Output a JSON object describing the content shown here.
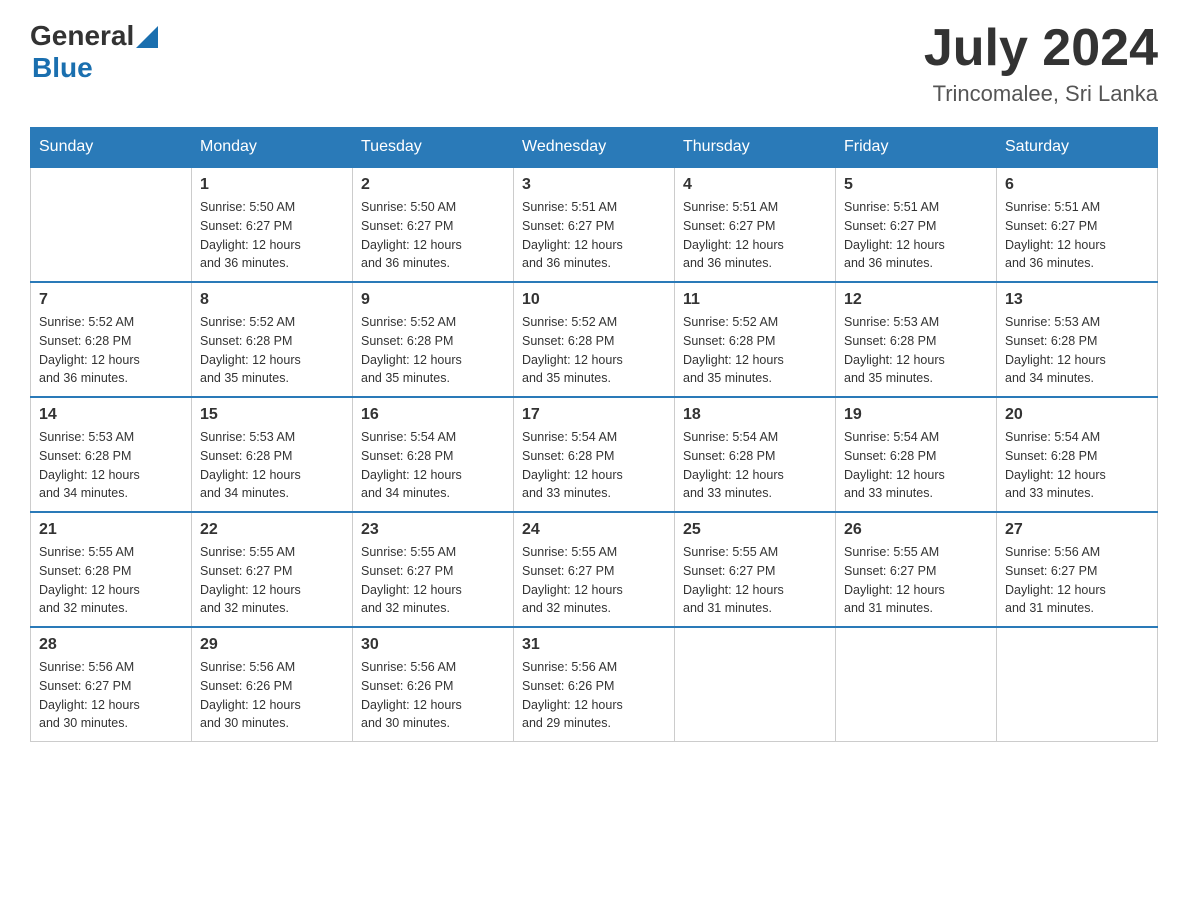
{
  "header": {
    "logo_general": "General",
    "logo_blue": "Blue",
    "title": "July 2024",
    "location": "Trincomalee, Sri Lanka"
  },
  "days_of_week": [
    "Sunday",
    "Monday",
    "Tuesday",
    "Wednesday",
    "Thursday",
    "Friday",
    "Saturday"
  ],
  "weeks": [
    [
      {
        "day": "",
        "info": ""
      },
      {
        "day": "1",
        "info": "Sunrise: 5:50 AM\nSunset: 6:27 PM\nDaylight: 12 hours\nand 36 minutes."
      },
      {
        "day": "2",
        "info": "Sunrise: 5:50 AM\nSunset: 6:27 PM\nDaylight: 12 hours\nand 36 minutes."
      },
      {
        "day": "3",
        "info": "Sunrise: 5:51 AM\nSunset: 6:27 PM\nDaylight: 12 hours\nand 36 minutes."
      },
      {
        "day": "4",
        "info": "Sunrise: 5:51 AM\nSunset: 6:27 PM\nDaylight: 12 hours\nand 36 minutes."
      },
      {
        "day": "5",
        "info": "Sunrise: 5:51 AM\nSunset: 6:27 PM\nDaylight: 12 hours\nand 36 minutes."
      },
      {
        "day": "6",
        "info": "Sunrise: 5:51 AM\nSunset: 6:27 PM\nDaylight: 12 hours\nand 36 minutes."
      }
    ],
    [
      {
        "day": "7",
        "info": "Sunrise: 5:52 AM\nSunset: 6:28 PM\nDaylight: 12 hours\nand 36 minutes."
      },
      {
        "day": "8",
        "info": "Sunrise: 5:52 AM\nSunset: 6:28 PM\nDaylight: 12 hours\nand 35 minutes."
      },
      {
        "day": "9",
        "info": "Sunrise: 5:52 AM\nSunset: 6:28 PM\nDaylight: 12 hours\nand 35 minutes."
      },
      {
        "day": "10",
        "info": "Sunrise: 5:52 AM\nSunset: 6:28 PM\nDaylight: 12 hours\nand 35 minutes."
      },
      {
        "day": "11",
        "info": "Sunrise: 5:52 AM\nSunset: 6:28 PM\nDaylight: 12 hours\nand 35 minutes."
      },
      {
        "day": "12",
        "info": "Sunrise: 5:53 AM\nSunset: 6:28 PM\nDaylight: 12 hours\nand 35 minutes."
      },
      {
        "day": "13",
        "info": "Sunrise: 5:53 AM\nSunset: 6:28 PM\nDaylight: 12 hours\nand 34 minutes."
      }
    ],
    [
      {
        "day": "14",
        "info": "Sunrise: 5:53 AM\nSunset: 6:28 PM\nDaylight: 12 hours\nand 34 minutes."
      },
      {
        "day": "15",
        "info": "Sunrise: 5:53 AM\nSunset: 6:28 PM\nDaylight: 12 hours\nand 34 minutes."
      },
      {
        "day": "16",
        "info": "Sunrise: 5:54 AM\nSunset: 6:28 PM\nDaylight: 12 hours\nand 34 minutes."
      },
      {
        "day": "17",
        "info": "Sunrise: 5:54 AM\nSunset: 6:28 PM\nDaylight: 12 hours\nand 33 minutes."
      },
      {
        "day": "18",
        "info": "Sunrise: 5:54 AM\nSunset: 6:28 PM\nDaylight: 12 hours\nand 33 minutes."
      },
      {
        "day": "19",
        "info": "Sunrise: 5:54 AM\nSunset: 6:28 PM\nDaylight: 12 hours\nand 33 minutes."
      },
      {
        "day": "20",
        "info": "Sunrise: 5:54 AM\nSunset: 6:28 PM\nDaylight: 12 hours\nand 33 minutes."
      }
    ],
    [
      {
        "day": "21",
        "info": "Sunrise: 5:55 AM\nSunset: 6:28 PM\nDaylight: 12 hours\nand 32 minutes."
      },
      {
        "day": "22",
        "info": "Sunrise: 5:55 AM\nSunset: 6:27 PM\nDaylight: 12 hours\nand 32 minutes."
      },
      {
        "day": "23",
        "info": "Sunrise: 5:55 AM\nSunset: 6:27 PM\nDaylight: 12 hours\nand 32 minutes."
      },
      {
        "day": "24",
        "info": "Sunrise: 5:55 AM\nSunset: 6:27 PM\nDaylight: 12 hours\nand 32 minutes."
      },
      {
        "day": "25",
        "info": "Sunrise: 5:55 AM\nSunset: 6:27 PM\nDaylight: 12 hours\nand 31 minutes."
      },
      {
        "day": "26",
        "info": "Sunrise: 5:55 AM\nSunset: 6:27 PM\nDaylight: 12 hours\nand 31 minutes."
      },
      {
        "day": "27",
        "info": "Sunrise: 5:56 AM\nSunset: 6:27 PM\nDaylight: 12 hours\nand 31 minutes."
      }
    ],
    [
      {
        "day": "28",
        "info": "Sunrise: 5:56 AM\nSunset: 6:27 PM\nDaylight: 12 hours\nand 30 minutes."
      },
      {
        "day": "29",
        "info": "Sunrise: 5:56 AM\nSunset: 6:26 PM\nDaylight: 12 hours\nand 30 minutes."
      },
      {
        "day": "30",
        "info": "Sunrise: 5:56 AM\nSunset: 6:26 PM\nDaylight: 12 hours\nand 30 minutes."
      },
      {
        "day": "31",
        "info": "Sunrise: 5:56 AM\nSunset: 6:26 PM\nDaylight: 12 hours\nand 29 minutes."
      },
      {
        "day": "",
        "info": ""
      },
      {
        "day": "",
        "info": ""
      },
      {
        "day": "",
        "info": ""
      }
    ]
  ]
}
